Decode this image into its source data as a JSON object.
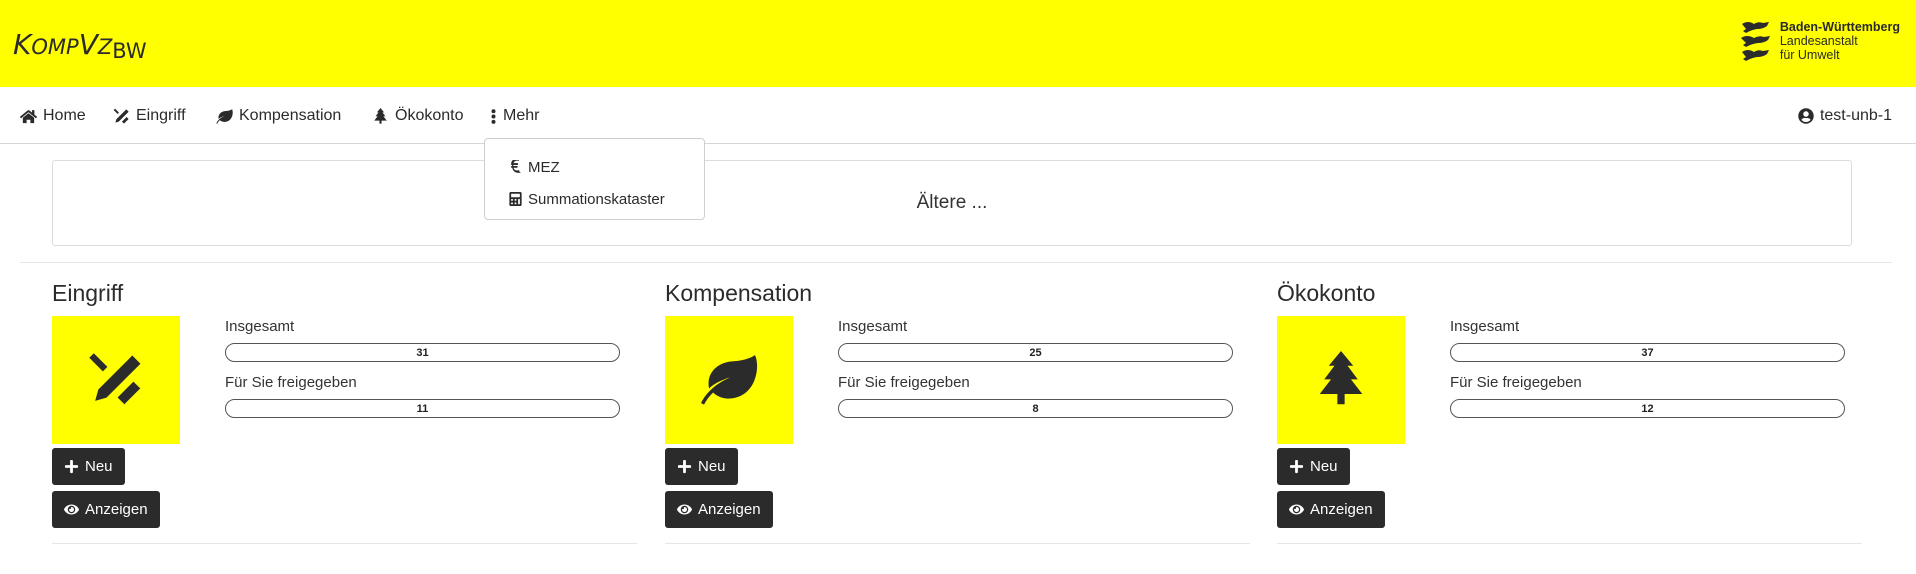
{
  "brand": {
    "k": "K",
    "omp": "OMP",
    "v": "V",
    "z": "Z",
    "bw": "BW"
  },
  "bw_logo": {
    "line1": "Baden-Württemberg",
    "line2": "Landesanstalt",
    "line3": "für Umwelt"
  },
  "nav": {
    "items": [
      {
        "label": "Home",
        "icon": "home-icon"
      },
      {
        "label": "Eingriff",
        "icon": "tools-icon"
      },
      {
        "label": "Kompensation",
        "icon": "leaf-icon"
      },
      {
        "label": "Ökokonto",
        "icon": "tree-icon"
      },
      {
        "label": "Mehr",
        "icon": "ellipsis-vertical-icon"
      }
    ],
    "user": "test-unb-1"
  },
  "dropdown": {
    "items": [
      {
        "label": "MEZ",
        "icon": "euro-icon"
      },
      {
        "label": "Summationskataster",
        "icon": "calculator-icon"
      }
    ]
  },
  "notice": "Ältere ...",
  "cards": [
    {
      "title": "Eingriff",
      "icon": "tools-icon",
      "total_label": "Insgesamt",
      "total": "31",
      "shared_label": "Für Sie freigegeben",
      "shared": "11",
      "new_label": "Neu",
      "show_label": "Anzeigen"
    },
    {
      "title": "Kompensation",
      "icon": "leaf-icon",
      "total_label": "Insgesamt",
      "total": "25",
      "shared_label": "Für Sie freigegeben",
      "shared": "8",
      "new_label": "Neu",
      "show_label": "Anzeigen"
    },
    {
      "title": "Ökokonto",
      "icon": "tree-icon",
      "total_label": "Insgesamt",
      "total": "37",
      "shared_label": "Für Sie freigegeben",
      "shared": "12",
      "new_label": "Neu",
      "show_label": "Anzeigen"
    }
  ],
  "colors": {
    "brand_yellow": "#ffff00",
    "dark": "#2b2b2b"
  }
}
